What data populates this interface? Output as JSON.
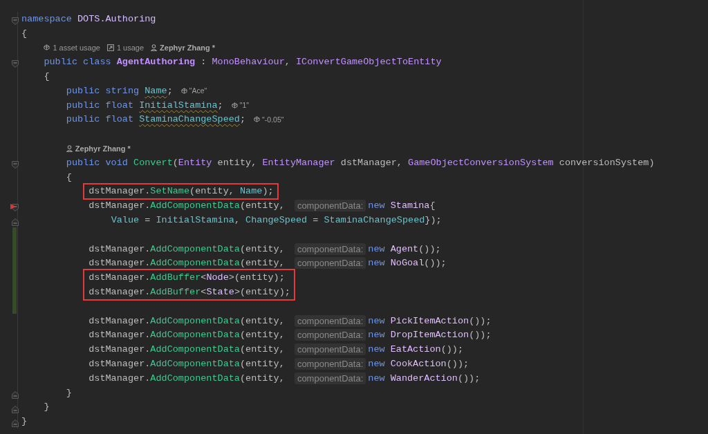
{
  "editor": {
    "lines": [
      {
        "kind": "code",
        "fold_start": true,
        "fold_end": false,
        "changed": false,
        "marker": false,
        "boxed": false,
        "tokens": [
          {
            "kind": "kw",
            "text": "namespace "
          },
          {
            "kind": "ns",
            "text": "DOTS.Authoring"
          }
        ]
      },
      {
        "kind": "code",
        "fold_start": false,
        "fold_end": false,
        "changed": false,
        "marker": false,
        "boxed": false,
        "tokens": [
          {
            "kind": "plain",
            "text": "{"
          }
        ]
      },
      {
        "kind": "lens",
        "fold_start": false,
        "fold_end": false,
        "changed": false,
        "marker": false,
        "boxed": false,
        "items": [
          {
            "kind": "asset-usage",
            "text": "1 asset usage"
          },
          {
            "kind": "usage",
            "text": "1 usage"
          },
          {
            "kind": "author",
            "text": "Zephyr Zhang *"
          }
        ]
      },
      {
        "kind": "code",
        "fold_start": true,
        "fold_end": false,
        "changed": false,
        "marker": false,
        "boxed": false,
        "tokens": [
          {
            "kind": "kw",
            "text": "    public class "
          },
          {
            "kind": "class-bold",
            "text": "AgentAuthoring"
          },
          {
            "kind": "plain",
            "text": " : "
          },
          {
            "kind": "type",
            "text": "MonoBehaviour"
          },
          {
            "kind": "plain",
            "text": ", "
          },
          {
            "kind": "type",
            "text": "IConvertGameObjectToEntity"
          }
        ]
      },
      {
        "kind": "code",
        "fold_start": false,
        "fold_end": false,
        "changed": false,
        "marker": false,
        "boxed": false,
        "tokens": [
          {
            "kind": "plain",
            "text": "    {"
          }
        ]
      },
      {
        "kind": "code",
        "fold_start": false,
        "fold_end": false,
        "changed": false,
        "marker": false,
        "boxed": false,
        "tokens": [
          {
            "kind": "kw",
            "text": "        public string "
          },
          {
            "kind": "field-warn",
            "text": "Name"
          },
          {
            "kind": "plain",
            "text": ";"
          },
          {
            "kind": "value-hint",
            "text": "\"Ace\""
          }
        ]
      },
      {
        "kind": "code",
        "fold_start": false,
        "fold_end": false,
        "changed": false,
        "marker": false,
        "boxed": false,
        "tokens": [
          {
            "kind": "kw",
            "text": "        public float "
          },
          {
            "kind": "field-warn",
            "text": "InitialStamina"
          },
          {
            "kind": "plain",
            "text": ";"
          },
          {
            "kind": "value-hint",
            "text": "\"1\""
          }
        ]
      },
      {
        "kind": "code",
        "fold_start": false,
        "fold_end": false,
        "changed": false,
        "marker": false,
        "boxed": false,
        "tokens": [
          {
            "kind": "kw",
            "text": "        public float "
          },
          {
            "kind": "field-warn",
            "text": "StaminaChangeSpeed"
          },
          {
            "kind": "plain",
            "text": ";"
          },
          {
            "kind": "value-hint",
            "text": "\"-0.05\""
          }
        ]
      },
      {
        "kind": "blank",
        "fold_start": false,
        "fold_end": false,
        "changed": false,
        "marker": false,
        "boxed": false
      },
      {
        "kind": "lens",
        "fold_start": false,
        "fold_end": false,
        "changed": false,
        "marker": false,
        "boxed": false,
        "items": [
          {
            "kind": "author",
            "text": "Zephyr Zhang *"
          }
        ]
      },
      {
        "kind": "code",
        "fold_start": true,
        "fold_end": false,
        "changed": false,
        "marker": false,
        "boxed": false,
        "tokens": [
          {
            "kind": "kw",
            "text": "        public void "
          },
          {
            "kind": "method",
            "text": "Convert"
          },
          {
            "kind": "plain",
            "text": "("
          },
          {
            "kind": "type",
            "text": "Entity"
          },
          {
            "kind": "plain",
            "text": " entity, "
          },
          {
            "kind": "type",
            "text": "EntityManager"
          },
          {
            "kind": "plain",
            "text": " dstManager, "
          },
          {
            "kind": "type",
            "text": "GameObjectConversionSystem"
          },
          {
            "kind": "plain",
            "text": " conversionSystem)"
          }
        ]
      },
      {
        "kind": "code",
        "fold_start": false,
        "fold_end": false,
        "changed": false,
        "marker": false,
        "boxed": false,
        "tokens": [
          {
            "kind": "plain",
            "text": "        {"
          }
        ]
      },
      {
        "kind": "code",
        "fold_start": false,
        "fold_end": false,
        "changed": false,
        "marker": false,
        "boxed": true,
        "tokens": [
          {
            "kind": "plain",
            "text": "            dstManager."
          },
          {
            "kind": "method",
            "text": "SetName"
          },
          {
            "kind": "plain",
            "text": "(entity, "
          },
          {
            "kind": "field",
            "text": "Name"
          },
          {
            "kind": "plain",
            "text": ");"
          }
        ]
      },
      {
        "kind": "code",
        "fold_start": true,
        "fold_end": false,
        "changed": false,
        "marker": true,
        "boxed": false,
        "tokens": [
          {
            "kind": "plain",
            "text": "            dstManager."
          },
          {
            "kind": "method",
            "text": "AddComponentData"
          },
          {
            "kind": "plain",
            "text": "(entity, "
          },
          {
            "kind": "inlay",
            "text": "componentData:"
          },
          {
            "kind": "kw",
            "text": "new "
          },
          {
            "kind": "struct",
            "text": "Stamina"
          },
          {
            "kind": "plain",
            "text": "{"
          }
        ]
      },
      {
        "kind": "code",
        "fold_start": false,
        "fold_end": true,
        "changed": false,
        "marker": false,
        "boxed": false,
        "tokens": [
          {
            "kind": "field",
            "text": "                Value"
          },
          {
            "kind": "plain",
            "text": " = "
          },
          {
            "kind": "field",
            "text": "InitialStamina"
          },
          {
            "kind": "plain",
            "text": ", "
          },
          {
            "kind": "field",
            "text": "ChangeSpeed"
          },
          {
            "kind": "plain",
            "text": " = "
          },
          {
            "kind": "field",
            "text": "StaminaChangeSpeed"
          },
          {
            "kind": "plain",
            "text": "});"
          }
        ]
      },
      {
        "kind": "blank",
        "fold_start": false,
        "fold_end": false,
        "changed": true,
        "marker": false,
        "boxed": false
      },
      {
        "kind": "code",
        "fold_start": false,
        "fold_end": false,
        "changed": true,
        "marker": false,
        "boxed": false,
        "tokens": [
          {
            "kind": "plain",
            "text": "            dstManager."
          },
          {
            "kind": "method",
            "text": "AddComponentData"
          },
          {
            "kind": "plain",
            "text": "(entity, "
          },
          {
            "kind": "inlay",
            "text": "componentData:"
          },
          {
            "kind": "kw",
            "text": "new "
          },
          {
            "kind": "struct",
            "text": "Agent"
          },
          {
            "kind": "plain",
            "text": "());"
          }
        ]
      },
      {
        "kind": "code",
        "fold_start": false,
        "fold_end": false,
        "changed": true,
        "marker": false,
        "boxed": false,
        "tokens": [
          {
            "kind": "plain",
            "text": "            dstManager."
          },
          {
            "kind": "method",
            "text": "AddComponentData"
          },
          {
            "kind": "plain",
            "text": "(entity, "
          },
          {
            "kind": "inlay",
            "text": "componentData:"
          },
          {
            "kind": "kw",
            "text": "new "
          },
          {
            "kind": "struct",
            "text": "NoGoal"
          },
          {
            "kind": "plain",
            "text": "());"
          }
        ]
      },
      {
        "kind": "code",
        "fold_start": false,
        "fold_end": false,
        "changed": true,
        "marker": false,
        "boxed": true,
        "tokens": [
          {
            "kind": "plain",
            "text": "            dstManager."
          },
          {
            "kind": "method",
            "text": "AddBuffer"
          },
          {
            "kind": "plain",
            "text": "<"
          },
          {
            "kind": "struct",
            "text": "Node"
          },
          {
            "kind": "plain",
            "text": ">(entity);"
          }
        ]
      },
      {
        "kind": "code",
        "fold_start": false,
        "fold_end": false,
        "changed": true,
        "marker": false,
        "boxed": true,
        "tokens": [
          {
            "kind": "plain",
            "text": "            dstManager."
          },
          {
            "kind": "method",
            "text": "AddBuffer"
          },
          {
            "kind": "plain",
            "text": "<"
          },
          {
            "kind": "struct",
            "text": "State"
          },
          {
            "kind": "plain",
            "text": ">(entity);"
          }
        ]
      },
      {
        "kind": "blank",
        "fold_start": false,
        "fold_end": false,
        "changed": true,
        "marker": false,
        "boxed": false
      },
      {
        "kind": "code",
        "fold_start": false,
        "fold_end": false,
        "changed": false,
        "marker": false,
        "boxed": false,
        "tokens": [
          {
            "kind": "plain",
            "text": "            dstManager."
          },
          {
            "kind": "method",
            "text": "AddComponentData"
          },
          {
            "kind": "plain",
            "text": "(entity, "
          },
          {
            "kind": "inlay",
            "text": "componentData:"
          },
          {
            "kind": "kw",
            "text": "new "
          },
          {
            "kind": "struct",
            "text": "PickItemAction"
          },
          {
            "kind": "plain",
            "text": "());"
          }
        ]
      },
      {
        "kind": "code",
        "fold_start": false,
        "fold_end": false,
        "changed": false,
        "marker": false,
        "boxed": false,
        "tokens": [
          {
            "kind": "plain",
            "text": "            dstManager."
          },
          {
            "kind": "method",
            "text": "AddComponentData"
          },
          {
            "kind": "plain",
            "text": "(entity, "
          },
          {
            "kind": "inlay",
            "text": "componentData:"
          },
          {
            "kind": "kw",
            "text": "new "
          },
          {
            "kind": "struct",
            "text": "DropItemAction"
          },
          {
            "kind": "plain",
            "text": "());"
          }
        ]
      },
      {
        "kind": "code",
        "fold_start": false,
        "fold_end": false,
        "changed": false,
        "marker": false,
        "boxed": false,
        "tokens": [
          {
            "kind": "plain",
            "text": "            dstManager."
          },
          {
            "kind": "method",
            "text": "AddComponentData"
          },
          {
            "kind": "plain",
            "text": "(entity, "
          },
          {
            "kind": "inlay",
            "text": "componentData:"
          },
          {
            "kind": "kw",
            "text": "new "
          },
          {
            "kind": "struct",
            "text": "EatAction"
          },
          {
            "kind": "plain",
            "text": "());"
          }
        ]
      },
      {
        "kind": "code",
        "fold_start": false,
        "fold_end": false,
        "changed": false,
        "marker": false,
        "boxed": false,
        "tokens": [
          {
            "kind": "plain",
            "text": "            dstManager."
          },
          {
            "kind": "method",
            "text": "AddComponentData"
          },
          {
            "kind": "plain",
            "text": "(entity, "
          },
          {
            "kind": "inlay",
            "text": "componentData:"
          },
          {
            "kind": "kw",
            "text": "new "
          },
          {
            "kind": "struct",
            "text": "CookAction"
          },
          {
            "kind": "plain",
            "text": "());"
          }
        ]
      },
      {
        "kind": "code",
        "fold_start": false,
        "fold_end": false,
        "changed": false,
        "marker": false,
        "boxed": false,
        "tokens": [
          {
            "kind": "plain",
            "text": "            dstManager."
          },
          {
            "kind": "method",
            "text": "AddComponentData"
          },
          {
            "kind": "plain",
            "text": "(entity, "
          },
          {
            "kind": "inlay",
            "text": "componentData:"
          },
          {
            "kind": "kw",
            "text": "new "
          },
          {
            "kind": "struct",
            "text": "WanderAction"
          },
          {
            "kind": "plain",
            "text": "());"
          }
        ]
      },
      {
        "kind": "code",
        "fold_start": false,
        "fold_end": true,
        "changed": false,
        "marker": false,
        "boxed": false,
        "tokens": [
          {
            "kind": "plain",
            "text": "        }"
          }
        ]
      },
      {
        "kind": "code",
        "fold_start": false,
        "fold_end": true,
        "changed": false,
        "marker": false,
        "boxed": false,
        "tokens": [
          {
            "kind": "plain",
            "text": "    }"
          }
        ]
      },
      {
        "kind": "code",
        "fold_start": false,
        "fold_end": true,
        "changed": false,
        "marker": false,
        "boxed": false,
        "tokens": [
          {
            "kind": "plain",
            "text": "}"
          }
        ]
      }
    ]
  }
}
